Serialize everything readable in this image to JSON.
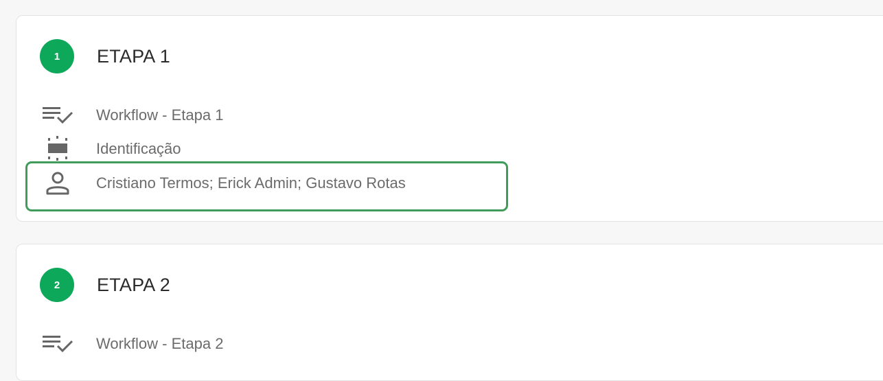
{
  "stages": [
    {
      "number": "1",
      "title": "ETAPA 1",
      "workflow": "Workflow - Etapa 1",
      "form": "Identificação",
      "assignees": "Cristiano Termos; Erick Admin; Gustavo Rotas"
    },
    {
      "number": "2",
      "title": "ETAPA 2",
      "workflow": "Workflow - Etapa 2"
    }
  ],
  "icons": {
    "workflow": "playlist-check-icon",
    "form": "form-identification-icon",
    "assignees": "person-icon"
  },
  "colors": {
    "step_circle": "#0ea85a",
    "highlight": "#3f9c5a",
    "page_background": "#f7f7f7",
    "card_background": "#ffffff"
  }
}
